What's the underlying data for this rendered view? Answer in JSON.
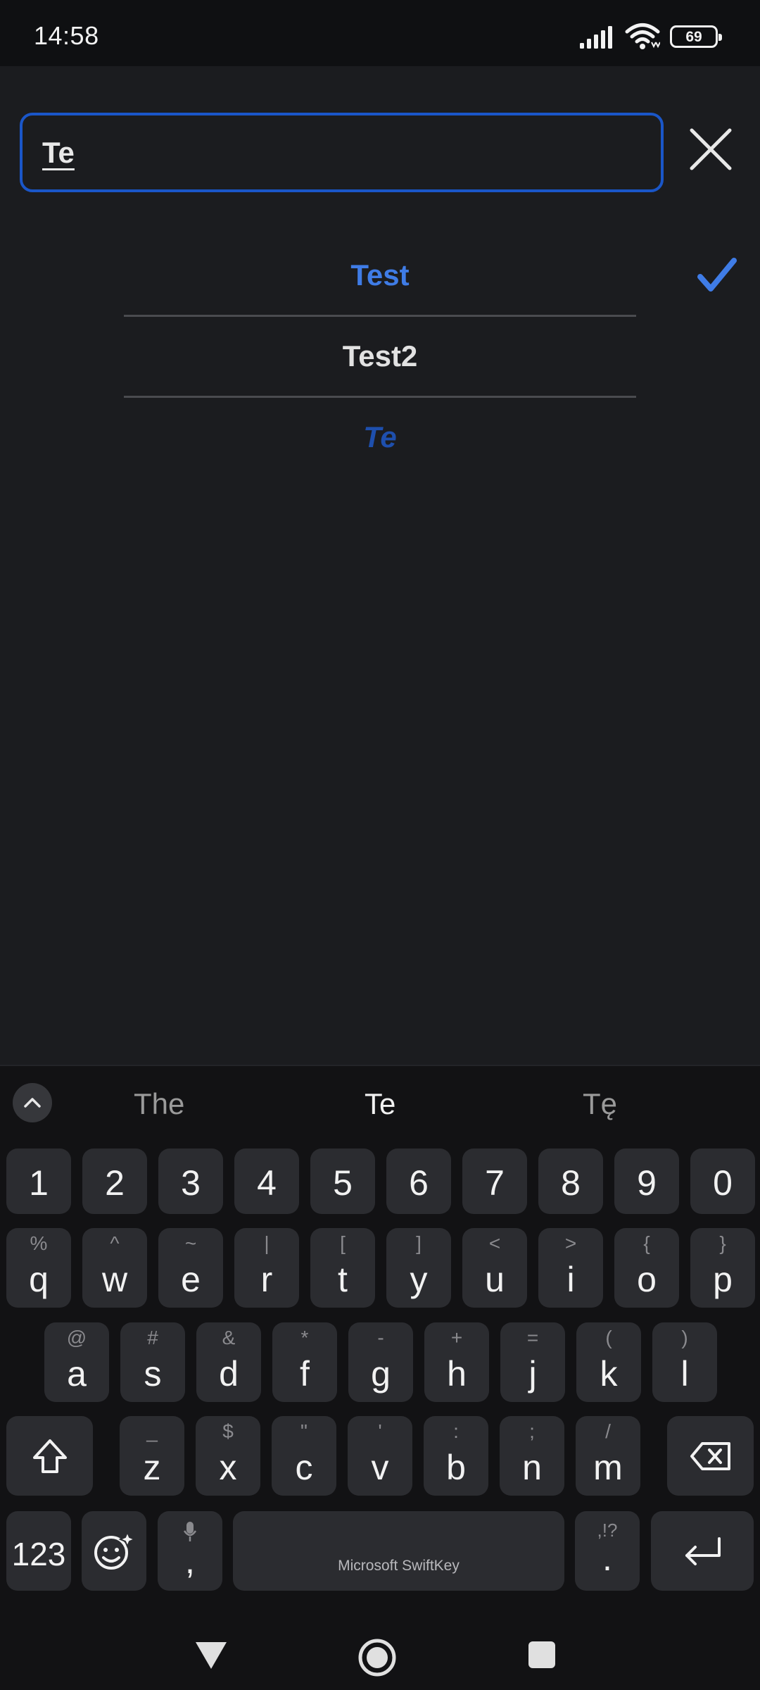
{
  "status_bar": {
    "time": "14:58",
    "battery_level": "69",
    "icons": [
      "signal-icon",
      "wifi-icon",
      "battery-icon"
    ]
  },
  "search": {
    "value": "Te"
  },
  "suggestions": [
    {
      "label": "Test",
      "state": "selected"
    },
    {
      "label": "Test2",
      "state": "plain"
    },
    {
      "label": "Te",
      "state": "new"
    }
  ],
  "keyboard": {
    "word_suggestions": [
      "The",
      "Te",
      "Tę"
    ],
    "number_row": [
      "1",
      "2",
      "3",
      "4",
      "5",
      "6",
      "7",
      "8",
      "9",
      "0"
    ],
    "row1": [
      {
        "main": "q",
        "sub": "%"
      },
      {
        "main": "w",
        "sub": "^"
      },
      {
        "main": "e",
        "sub": "~"
      },
      {
        "main": "r",
        "sub": "|"
      },
      {
        "main": "t",
        "sub": "["
      },
      {
        "main": "y",
        "sub": "]"
      },
      {
        "main": "u",
        "sub": "<"
      },
      {
        "main": "i",
        "sub": ">"
      },
      {
        "main": "o",
        "sub": "{"
      },
      {
        "main": "p",
        "sub": "}"
      }
    ],
    "row2": [
      {
        "main": "a",
        "sub": "@"
      },
      {
        "main": "s",
        "sub": "#"
      },
      {
        "main": "d",
        "sub": "&"
      },
      {
        "main": "f",
        "sub": "*"
      },
      {
        "main": "g",
        "sub": "-"
      },
      {
        "main": "h",
        "sub": "+"
      },
      {
        "main": "j",
        "sub": "="
      },
      {
        "main": "k",
        "sub": "("
      },
      {
        "main": "l",
        "sub": ")"
      }
    ],
    "row3": [
      {
        "main": "z",
        "sub": "_"
      },
      {
        "main": "x",
        "sub": "$"
      },
      {
        "main": "c",
        "sub": "\""
      },
      {
        "main": "v",
        "sub": "'"
      },
      {
        "main": "b",
        "sub": ":"
      },
      {
        "main": "n",
        "sub": ";"
      },
      {
        "main": "m",
        "sub": "/"
      }
    ],
    "mode_key": "123",
    "comma": ",",
    "period": ".",
    "period_sub": ",!?",
    "space_label": "Microsoft SwiftKey"
  },
  "colors": {
    "accent": "#3f7ce6",
    "field_border": "#1a56c8",
    "new_item": "#1e4fad",
    "background": "#1b1c1f",
    "key": "#2b2c30"
  }
}
